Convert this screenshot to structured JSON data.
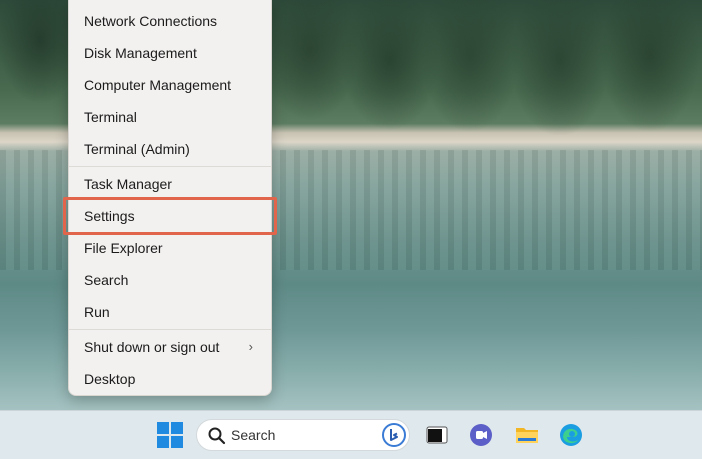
{
  "menu": {
    "items": [
      {
        "label": "Network Connections"
      },
      {
        "label": "Disk Management"
      },
      {
        "label": "Computer Management"
      },
      {
        "label": "Terminal"
      },
      {
        "label": "Terminal (Admin)"
      },
      {
        "label": "Task Manager"
      },
      {
        "label": "Settings"
      },
      {
        "label": "File Explorer"
      },
      {
        "label": "Search"
      },
      {
        "label": "Run"
      },
      {
        "label": "Shut down or sign out"
      },
      {
        "label": "Desktop"
      }
    ],
    "highlighted": "Settings",
    "submenu_icon": "chevron-right-icon"
  },
  "taskbar": {
    "search_placeholder": "Search",
    "icons": [
      "windows-start-icon",
      "search-icon",
      "bing-icon",
      "task-view-icon",
      "teams-chat-icon",
      "file-explorer-icon",
      "edge-icon"
    ]
  },
  "colors": {
    "highlight": "#e0654a",
    "accent": "#1f8ae0"
  }
}
